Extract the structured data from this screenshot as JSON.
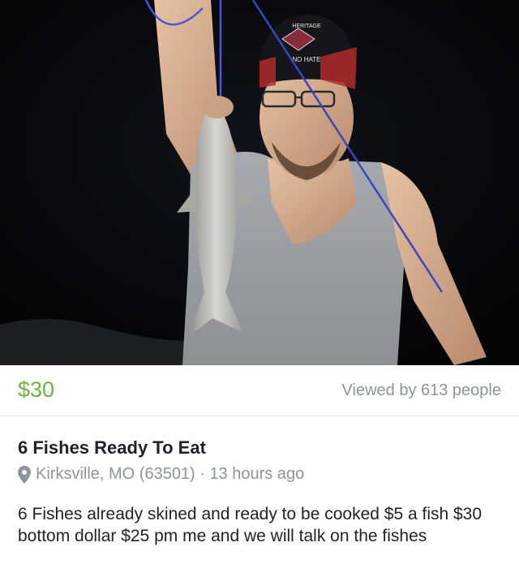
{
  "listing": {
    "price": "$30",
    "views": "Viewed by 613 people",
    "title": "6 Fishes Ready To Eat",
    "location": "Kirksville, MO (63501)",
    "separator": " · ",
    "time_posted": "13 hours ago",
    "description": "6 Fishes already skined and ready to be cooked $5 a fish $30 bottom dollar $25 pm me and we will talk on the fishes"
  },
  "photo": {
    "cap_text_top": "HERITAGE",
    "cap_text_bottom": "NO HATE"
  },
  "colors": {
    "price_green": "#6cb33f",
    "muted_gray": "#8d949e",
    "text_dark": "#1d2129"
  },
  "icons": {
    "location": "map-pin-icon"
  }
}
